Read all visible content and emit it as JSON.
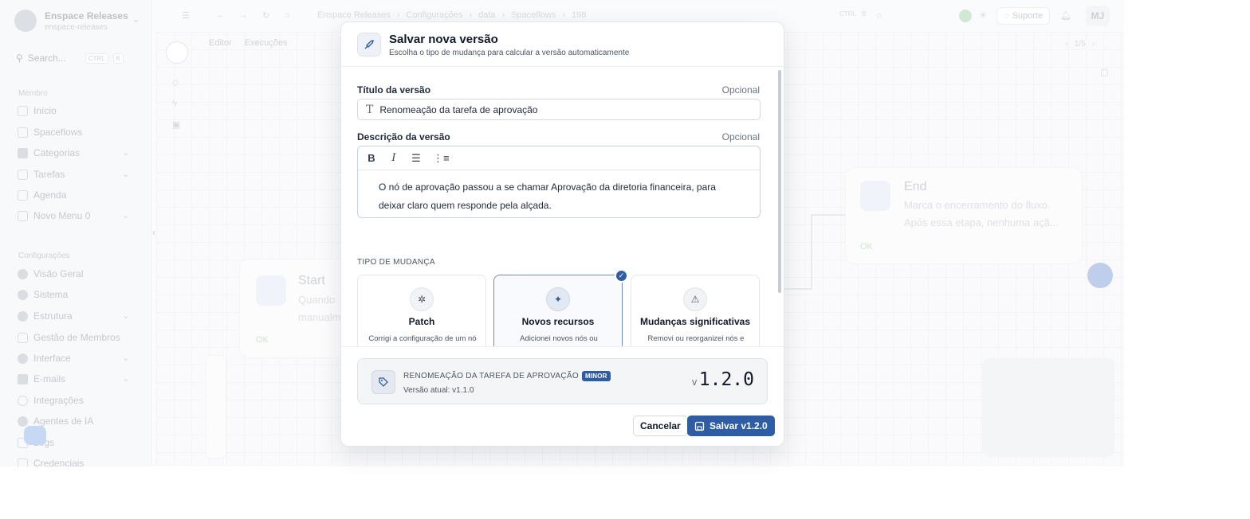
{
  "workspace": {
    "name": "Enspace Releases",
    "slug": "enspace-releases"
  },
  "search": {
    "label": "Search...",
    "kbd1": "CTRL",
    "kbd2": "K"
  },
  "sidebar": {
    "section_member": "Membro",
    "member_items": [
      {
        "label": "Início"
      },
      {
        "label": "Spaceflows"
      },
      {
        "label": "Categorias"
      },
      {
        "label": "Tarefas"
      },
      {
        "label": "Agenda"
      },
      {
        "label": "Novo Menu 0"
      }
    ],
    "section_config": "Configurações",
    "config_items": [
      {
        "label": "Visão Geral"
      },
      {
        "label": "Sistema"
      },
      {
        "label": "Estrutura"
      },
      {
        "label": "Gestão de Membros"
      },
      {
        "label": "Interface"
      },
      {
        "label": "E-mails"
      },
      {
        "label": "Integrações"
      },
      {
        "label": "Agentes de IA"
      },
      {
        "label": "Logs"
      },
      {
        "label": "Credenciais"
      }
    ]
  },
  "topbar": {
    "breadcrumbs": [
      "Enspace Releases",
      "Configurações",
      "data",
      "Spaceflows",
      "198"
    ],
    "kbd1": "CTRL",
    "kbd2": "B",
    "support": "Suporte",
    "user_initials": "MJ"
  },
  "canvas": {
    "tabs": [
      "Editor",
      "Execuções"
    ],
    "pager": "1/5",
    "start": {
      "title": "Start",
      "desc1": "Quando",
      "desc2": "manualm",
      "status": "OK"
    },
    "end": {
      "title": "End",
      "desc1": "Marca o encerramento do fluxo.",
      "desc2": "Após essa etapa, nenhuma açã...",
      "status": "OK"
    }
  },
  "modal": {
    "title": "Salvar nova versão",
    "subtitle": "Escolha o tipo de mudança para calcular a versão automaticamente",
    "title_label": "Título da versão",
    "optional": "Opcional",
    "title_value": "Renomeação da tarefa de aprovação",
    "desc_label": "Descrição da versão",
    "desc_text": "O nó de aprovação passou a se chamar Aprovação da diretoria financeira, para deixar claro quem responde pela alçada.",
    "change_type_label": "TIPO DE MUDANÇA",
    "cards": [
      {
        "title": "Patch",
        "desc": "Corrigi a configuração de um nó ou ajustei um texto, sem alterar a estrutura do fluxo.",
        "icon": "bug-icon"
      },
      {
        "title": "Novos recursos",
        "desc": "Adicionei novos nós ou conexões ao fluxo, sem afetar o que já existia.",
        "icon": "sparkles-icon"
      },
      {
        "title": "Mudanças significativas",
        "desc": "Removi ou reorganizei nós e conexões de um jeito que muda o comportamento do",
        "icon": "warning-icon"
      }
    ],
    "summary": {
      "title": "RENOMEAÇÃO DA TAREFA DE APROVAÇÃO",
      "badge": "MINOR",
      "current": "Versão atual: v1.1.0",
      "prefix": "v",
      "version": "1.2.0"
    },
    "cancel": "Cancelar",
    "save": "Salvar v1.2.0"
  },
  "colors": {
    "accent": "#2f5da3"
  }
}
